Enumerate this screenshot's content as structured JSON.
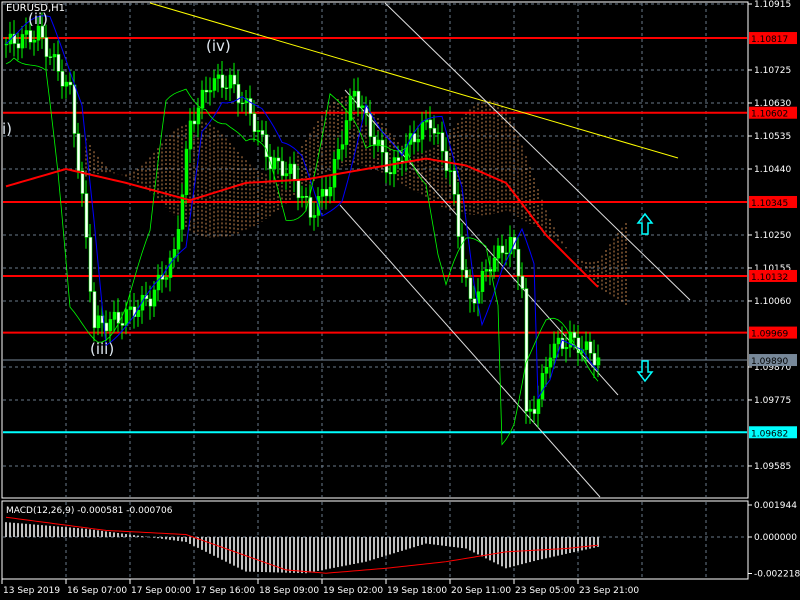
{
  "title": "EURUSD,H1",
  "macd_label": "MACD(12,26,9) -0.000581 -0.000706",
  "wave_labels": [
    "(ii)",
    "(iv)",
    "(iii)",
    "i)"
  ],
  "colors": {
    "bull": "#00ff00",
    "bear": "#ffffff",
    "level": "#ff0000",
    "support": "#00ffff",
    "trend": "#ffff00",
    "cloud": "#f4a460",
    "grid": "#6a7a8a",
    "current": "#778899"
  },
  "chart_data": {
    "type": "candlestick",
    "symbol": "EURUSD",
    "timeframe": "H1",
    "ylim": [
      1.0949,
      1.1094
    ],
    "price_ticks": [
      "1.10915",
      "1.10725",
      "1.10630",
      "1.10535",
      "1.10440",
      "1.10250",
      "1.10155",
      "1.10060",
      "1.09870",
      "1.09775",
      "1.09585"
    ],
    "levels": [
      {
        "label": "1.10817",
        "value": 1.10817,
        "kind": "resistance"
      },
      {
        "label": "1.10602",
        "value": 1.10602,
        "kind": "resistance"
      },
      {
        "label": "1.10345",
        "value": 1.10345,
        "kind": "resistance"
      },
      {
        "label": "1.10132",
        "value": 1.10132,
        "kind": "resistance"
      },
      {
        "label": "1.09969",
        "value": 1.09969,
        "kind": "resistance"
      },
      {
        "label": "1.09682",
        "value": 1.09682,
        "kind": "support"
      }
    ],
    "current_price": {
      "label": "1.09890",
      "value": 1.0989
    },
    "time_labels": [
      "13 Sep 2019",
      "16 Sep 07:00",
      "17 Sep 00:00",
      "17 Sep 16:00",
      "18 Sep 09:00",
      "19 Sep 02:00",
      "19 Sep 18:00",
      "20 Sep 11:00",
      "23 Sep 05:00",
      "23 Sep 21:00"
    ],
    "close_anchors_bar_price": [
      [
        0,
        1.108
      ],
      [
        8,
        1.1083
      ],
      [
        16,
        1.1066
      ],
      [
        19,
        1.1035
      ],
      [
        22,
        1.0999
      ],
      [
        29,
        1.1001
      ],
      [
        36,
        1.1007
      ],
      [
        42,
        1.1019
      ],
      [
        46,
        1.1057
      ],
      [
        51,
        1.1069
      ],
      [
        56,
        1.1069
      ],
      [
        61,
        1.106
      ],
      [
        66,
        1.1046
      ],
      [
        71,
        1.1043
      ],
      [
        76,
        1.1031
      ],
      [
        81,
        1.104
      ],
      [
        87,
        1.1067
      ],
      [
        91,
        1.1055
      ],
      [
        96,
        1.1043
      ],
      [
        101,
        1.1052
      ],
      [
        106,
        1.1058
      ],
      [
        111,
        1.1043
      ],
      [
        114,
        1.1017
      ],
      [
        116,
        1.1005
      ],
      [
        121,
        1.1017
      ],
      [
        126,
        1.1023
      ],
      [
        129,
        1.1011
      ],
      [
        130,
        1.0972
      ],
      [
        133,
        1.0978
      ],
      [
        136,
        1.0992
      ],
      [
        141,
        1.0995
      ],
      [
        146,
        1.0991
      ],
      [
        148,
        1.0989
      ]
    ],
    "ma_red_anchors": [
      [
        0,
        1.1039
      ],
      [
        15,
        1.1044
      ],
      [
        30,
        1.104
      ],
      [
        46,
        1.1035
      ],
      [
        60,
        1.104
      ],
      [
        75,
        1.1041
      ],
      [
        90,
        1.1044
      ],
      [
        105,
        1.1047
      ],
      [
        115,
        1.1045
      ],
      [
        125,
        1.104
      ],
      [
        135,
        1.1025
      ],
      [
        148,
        1.101
      ]
    ],
    "macd": {
      "ticks": [
        "0.001944",
        "0.000000",
        "-0.002218"
      ],
      "ylim": [
        -0.00245,
        0.00215
      ],
      "hist_anchors": [
        [
          0,
          0.0009
        ],
        [
          20,
          0.0005
        ],
        [
          45,
          -0.0003
        ],
        [
          60,
          -0.0021
        ],
        [
          75,
          -0.0022
        ],
        [
          90,
          -0.0015
        ],
        [
          105,
          -0.0004
        ],
        [
          115,
          -0.0007
        ],
        [
          125,
          -0.0019
        ],
        [
          133,
          -0.0014
        ],
        [
          148,
          -0.0006
        ]
      ],
      "signal_anchors": [
        [
          0,
          0.0012
        ],
        [
          25,
          0.0004
        ],
        [
          45,
          0.00015
        ],
        [
          70,
          -0.002
        ],
        [
          80,
          -0.0022
        ],
        [
          95,
          -0.0019
        ],
        [
          110,
          -0.0015
        ],
        [
          125,
          -0.0009
        ],
        [
          140,
          -0.0007
        ],
        [
          148,
          -0.0005
        ]
      ]
    }
  }
}
